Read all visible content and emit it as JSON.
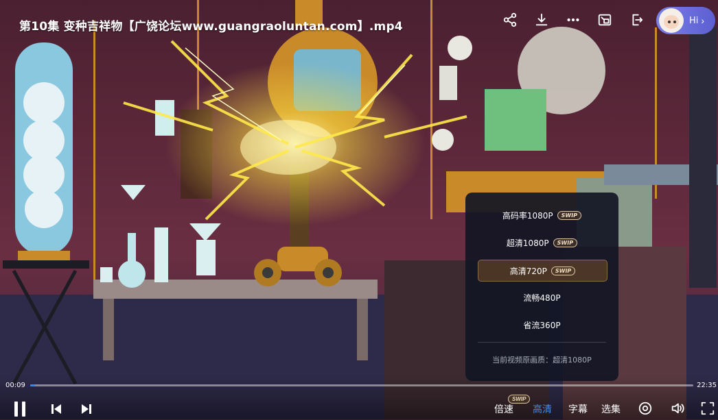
{
  "video": {
    "title": "第10集 变种吉祥物【广饶论坛www.guangraoluntan.com】.mp4",
    "current_time": "00:09",
    "duration": "22:35",
    "progress": 0.007
  },
  "top_bar": {
    "hi_label": "Hi",
    "icons": [
      "share-icon",
      "download-icon",
      "more-icon",
      "pip-icon",
      "exit-icon"
    ]
  },
  "quality_menu": {
    "options": [
      {
        "label": "高码率1080P",
        "badge": "SWIP",
        "selected": false
      },
      {
        "label": "超清1080P",
        "badge": "SWIP",
        "selected": false
      },
      {
        "label": "高清720P",
        "badge": "SWIP",
        "selected": true
      },
      {
        "label": "流畅480P",
        "badge": "",
        "selected": false
      },
      {
        "label": "省流360P",
        "badge": "",
        "selected": false
      }
    ],
    "note": "当前视频原画质：超清1080P"
  },
  "controls": {
    "speed_label": "倍速",
    "speed_badge": "SWIP",
    "quality_label": "高清",
    "subtitle_label": "字幕",
    "episodes_label": "选集"
  },
  "colors": {
    "accent": "#3b8cf6",
    "panel_bg": "#12162a",
    "scene_bg": "#5a2a3c"
  }
}
